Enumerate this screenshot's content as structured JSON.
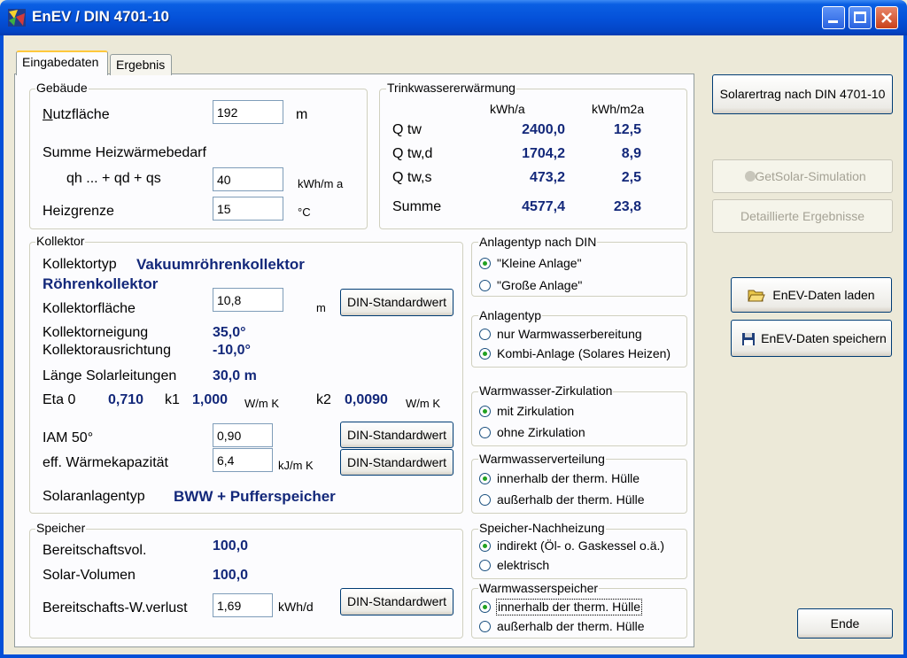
{
  "window": {
    "title": "EnEV / DIN 4701-10"
  },
  "tabs": [
    {
      "label": "Eingabedaten",
      "active": true
    },
    {
      "label": "Ergebnis",
      "active": false
    }
  ],
  "gebaeude": {
    "legend": "Gebäude",
    "nutzflaeche_label": "Nutzfläche",
    "nutzflaeche_value": "192",
    "nutzflaeche_unit": "m",
    "summe_label": "Summe Heizwärmebedarf",
    "qh_label": "qh ... + qd + qs",
    "qh_value": "40",
    "qh_unit": "kWh/m a",
    "heizgrenze_label": "Heizgrenze",
    "heizgrenze_value": "15",
    "heizgrenze_unit": "°C"
  },
  "trinkwasser": {
    "legend": "Trinkwassererwärmung",
    "col1": "kWh/a",
    "col2": "kWh/m2a",
    "rows": [
      {
        "label": "Q tw",
        "v1": "2400,0",
        "v2": "12,5"
      },
      {
        "label": "Q tw,d",
        "v1": "1704,2",
        "v2": "8,9"
      },
      {
        "label": "Q tw,s",
        "v1": "473,2",
        "v2": "2,5"
      },
      {
        "label": "Summe",
        "v1": "4577,4",
        "v2": "23,8"
      }
    ]
  },
  "kollektor": {
    "legend": "Kollektor",
    "typ_label": "Kollektortyp",
    "typ_value1": "Vakuumröhrenkollektor",
    "typ_value2": "Röhrenkollektor",
    "flaeche_label": "Kollektorfläche",
    "flaeche_value": "10,8",
    "flaeche_unit": "m",
    "neigung_label": "Kollektorneigung",
    "neigung_value": "35,0°",
    "ausrichtung_label": "Kollektorausrichtung",
    "ausrichtung_value": "-10,0°",
    "laenge_label": "Länge Solarleitungen",
    "laenge_value": "30,0 m",
    "eta_label": "Eta 0",
    "eta_value": "0,710",
    "k1_label": "k1",
    "k1_value": "1,000",
    "k1_unit": "W/m K",
    "k2_label": "k2",
    "k2_value": "0,0090",
    "k2_unit": "W/m K",
    "iam_label": "IAM 50°",
    "iam_value": "0,90",
    "kap_label": "eff. Wärmekapazität",
    "kap_value": "6,4",
    "kap_unit": "kJ/m K",
    "solartyp_label": "Solaranlagentyp",
    "solartyp_value": "BWW + Pufferspeicher",
    "std_btn": "DIN-Standardwert"
  },
  "speicher": {
    "legend": "Speicher",
    "bereit_label": "Bereitschaftsvol.",
    "bereit_value": "100,0",
    "solar_label": "Solar-Volumen",
    "solar_value": "100,0",
    "verlust_label": "Bereitschafts-W.verlust",
    "verlust_value": "1,69",
    "verlust_unit": "kWh/d",
    "std_btn": "DIN-Standardwert"
  },
  "anlagentyp_din": {
    "legend": "Anlagentyp nach DIN",
    "opt1": "\"Kleine Anlage\"",
    "opt2": "\"Große Anlage\""
  },
  "anlagentyp": {
    "legend": "Anlagentyp",
    "opt1": "nur Warmwasserbereitung",
    "opt2": "Kombi-Anlage (Solares Heizen)"
  },
  "zirkulation": {
    "legend": "Warmwasser-Zirkulation",
    "opt1": "mit Zirkulation",
    "opt2": "ohne Zirkulation"
  },
  "verteilung": {
    "legend": "Warmwasserverteilung",
    "opt1": "innerhalb der therm. Hülle",
    "opt2": "außerhalb der therm. Hülle"
  },
  "nachheizung": {
    "legend": "Speicher-Nachheizung",
    "opt1": "indirekt (Öl- o. Gaskessel o.ä.)",
    "opt2": "elektrisch"
  },
  "wwspeicher": {
    "legend": "Warmwasserspeicher",
    "opt1": "innerhalb der therm. Hülle",
    "opt2": "außerhalb der therm. Hülle"
  },
  "right": {
    "solarertrag": "Solarertrag nach DIN 4701-10",
    "getsolar": "GetSolar-Simulation",
    "detail": "Detaillierte Ergebnisse",
    "laden": "EnEV-Daten laden",
    "speichern": "EnEV-Daten speichern",
    "ende": "Ende"
  },
  "colors": {
    "titlebar": "#0450d8",
    "value": "#13287a",
    "background": "#ece9d8"
  }
}
